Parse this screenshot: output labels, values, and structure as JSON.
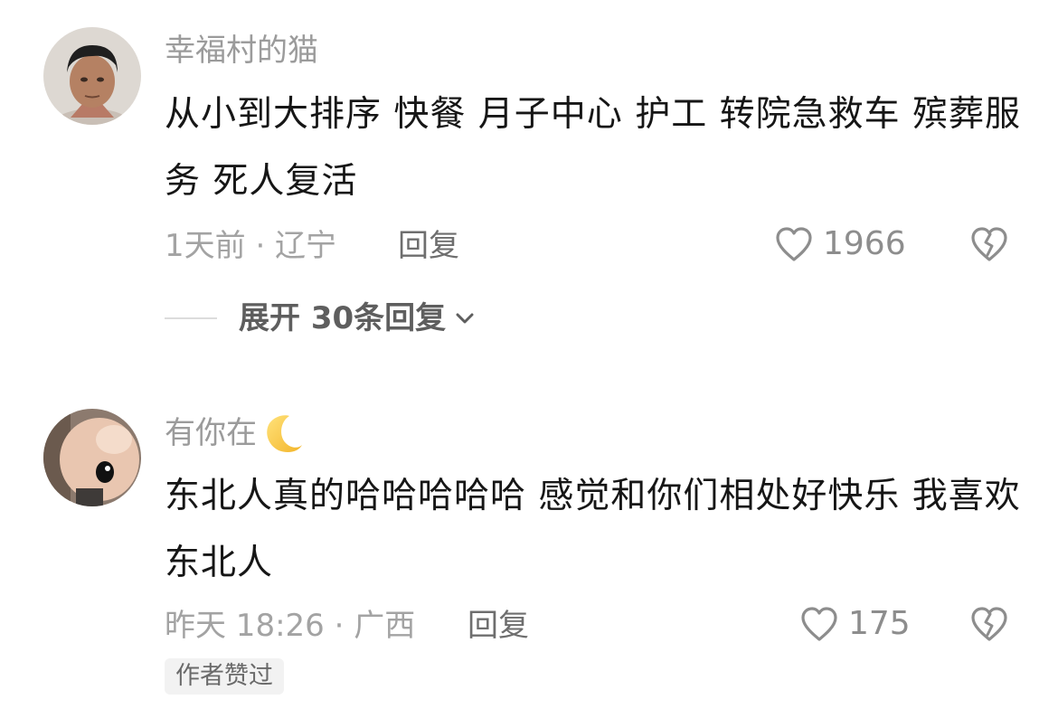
{
  "comments": [
    {
      "username": "幸福村的猫",
      "text": "从小到大排序 快餐 月子中心 护工 转院急救车 殡葬服务 死人复活",
      "meta": "1天前 · 辽宁",
      "reply_label": "回复",
      "likes": "1966",
      "expand_label": "展开 30条回复",
      "avatar_icon": "man-portrait-avatar",
      "colors": {
        "like": "#8d8d8d",
        "text": "#161616",
        "meta": "#a3a3a3"
      }
    },
    {
      "username": "有你在",
      "username_emoji": "crescent-moon-icon",
      "text": "东北人真的哈哈哈哈哈 感觉和你们相处好快乐 我喜欢东北人",
      "meta": "昨天 18:26 · 广西",
      "reply_label": "回复",
      "likes": "175",
      "badge": "作者赞过",
      "avatar_icon": "hamster-avatar"
    }
  ]
}
